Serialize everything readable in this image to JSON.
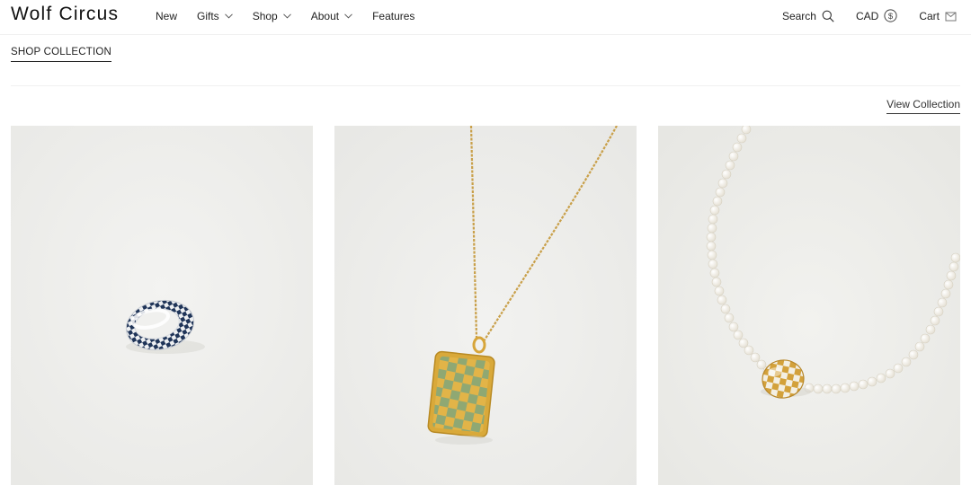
{
  "brand": {
    "logo": "Wolf Circus"
  },
  "nav": {
    "items": [
      {
        "label": "New",
        "dropdown": false
      },
      {
        "label": "Gifts",
        "dropdown": true
      },
      {
        "label": "Shop",
        "dropdown": true
      },
      {
        "label": "About",
        "dropdown": true
      },
      {
        "label": "Features",
        "dropdown": false
      }
    ]
  },
  "utility": {
    "search_label": "Search",
    "currency_label": "CAD",
    "cart_label": "Cart"
  },
  "section": {
    "shop_collection_label": "SHOP COLLECTION",
    "view_collection_label": "View Collection"
  },
  "products": [
    {
      "icon": "checkered-ring-image",
      "colors": {
        "enamel": "#1f3458",
        "metal": "#e9ecef"
      }
    },
    {
      "icon": "checkered-pendant-necklace-image",
      "colors": {
        "enamel": "#8fa873",
        "metal": "#d9a93a"
      }
    },
    {
      "icon": "pearl-necklace-checkered-bead-image",
      "colors": {
        "enamel": "#f3efe3",
        "metal": "#d3a13b"
      }
    }
  ]
}
